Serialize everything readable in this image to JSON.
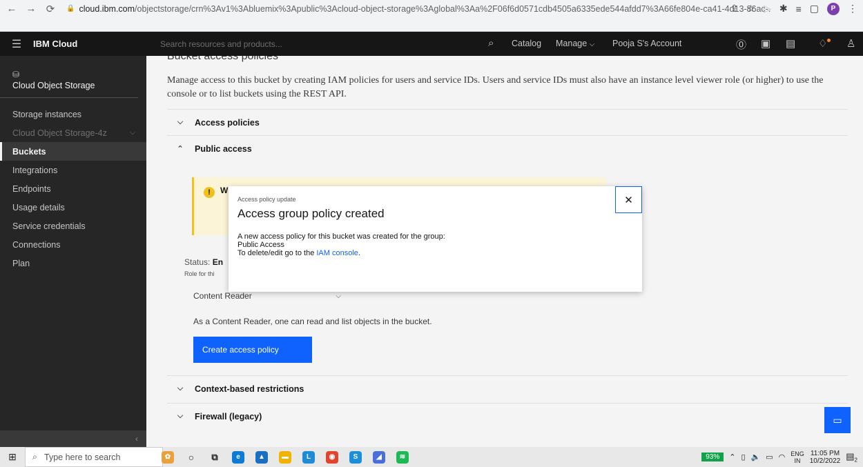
{
  "browser": {
    "url_host": "cloud.ibm.com",
    "url_path": "/objectstorage/crn%3Av1%3Abluemix%3Apublic%3Acloud-object-storage%3Aglobal%3Aa%2F06f6d0571cdb4505a6335ede544afdd7%3A66fe804e-ca41-4d13-86ac-...",
    "profile_initial": "P"
  },
  "header": {
    "brand": "IBM Cloud",
    "search_placeholder": "Search resources and products...",
    "catalog": "Catalog",
    "manage": "Manage",
    "account": "Pooja S's Account"
  },
  "sidebar": {
    "title": "Cloud Object Storage",
    "items": [
      {
        "label": "Storage instances"
      },
      {
        "label": "Cloud Object Storage-4z"
      },
      {
        "label": "Buckets"
      },
      {
        "label": "Integrations"
      },
      {
        "label": "Endpoints"
      },
      {
        "label": "Usage details"
      },
      {
        "label": "Service credentials"
      },
      {
        "label": "Connections"
      },
      {
        "label": "Plan"
      }
    ]
  },
  "main": {
    "heading": "Bucket access policies",
    "description": "Manage access to this bucket by creating IAM policies for users and service IDs. Users and service IDs must also have an instance level viewer role (or higher) to use the console or to list buckets using the REST API.",
    "sections": {
      "access_policies": "Access policies",
      "public_access": "Public access",
      "context_restrictions": "Context-based restrictions",
      "firewall": "Firewall (legacy)"
    },
    "status_label": "Status:",
    "status_value": "En",
    "role_label": "Role for thi",
    "role_value": "Content Reader",
    "role_description": "As a Content Reader, one can read and list objects in the bucket.",
    "create_button": "Create access policy",
    "warning_fragment": "W"
  },
  "modal": {
    "label": "Access policy update",
    "title": "Access group policy created",
    "line1": "A new access policy for this bucket was created for the group:",
    "line2": "Public Access",
    "line3_prefix": "To delete/edit go to the ",
    "line3_link": "IAM console",
    "line3_suffix": "."
  },
  "taskbar": {
    "search_placeholder": "Type here to search",
    "battery": "93%",
    "lang_top": "ENG",
    "lang_bottom": "IN",
    "time": "11:05 PM",
    "date": "10/2/2022",
    "notification_count": "2"
  }
}
